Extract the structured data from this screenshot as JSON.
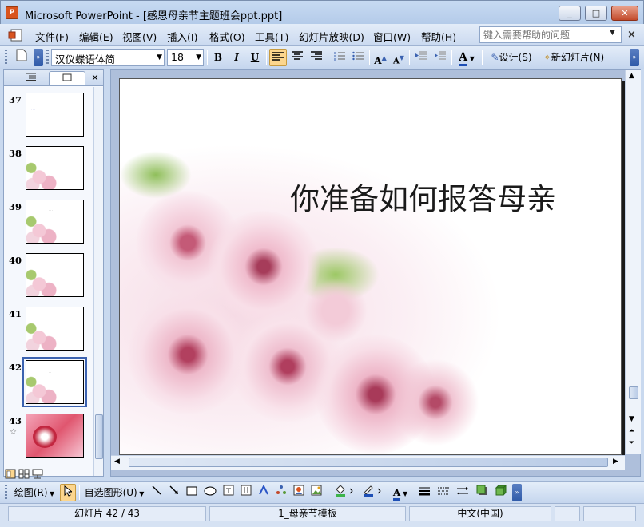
{
  "window": {
    "app_title": "Microsoft PowerPoint",
    "document_title": " - [感恩母亲节主题班会ppt.ppt]",
    "minimize_label": "_",
    "maximize_label": "□",
    "close_label": "✕"
  },
  "menu": {
    "items": [
      "文件(F)",
      "编辑(E)",
      "视图(V)",
      "插入(I)",
      "格式(O)",
      "工具(T)",
      "幻灯片放映(D)",
      "窗口(W)",
      "帮助(H)"
    ],
    "help_placeholder": "键入需要帮助的问题"
  },
  "toolbar": {
    "font_name": "汉仪蝶语体简",
    "font_size": "18",
    "bold": "B",
    "italic": "I",
    "underline": "U",
    "design_label": "设计(S)",
    "new_slide_label": "新幻灯片(N)"
  },
  "left_pane": {
    "thumbnails": [
      {
        "number": "37",
        "caption": "· · ·"
      },
      {
        "number": "38",
        "caption": "· ·"
      },
      {
        "number": "39",
        "caption": "· · ·"
      },
      {
        "number": "40",
        "caption": "· ·"
      },
      {
        "number": "41",
        "caption": "· · ·"
      },
      {
        "number": "42",
        "caption": "· ·",
        "selected": true
      },
      {
        "number": "43",
        "caption": "",
        "star": "☆"
      }
    ]
  },
  "slide": {
    "title": "你准备如何报答母亲"
  },
  "drawing_toolbar": {
    "draw_label": "绘图(R)",
    "autoshapes_label": "自选图形(U)"
  },
  "status": {
    "slide_position": "幻灯片 42 / 43",
    "template": "1_母亲节模板",
    "language": "中文(中国)"
  },
  "colors": {
    "accent_selection": "#fcd68e",
    "chrome_blue": "#c5d6ee",
    "blossom_pink": "#f4c8d6",
    "leaf_green": "#8fbf5a"
  }
}
